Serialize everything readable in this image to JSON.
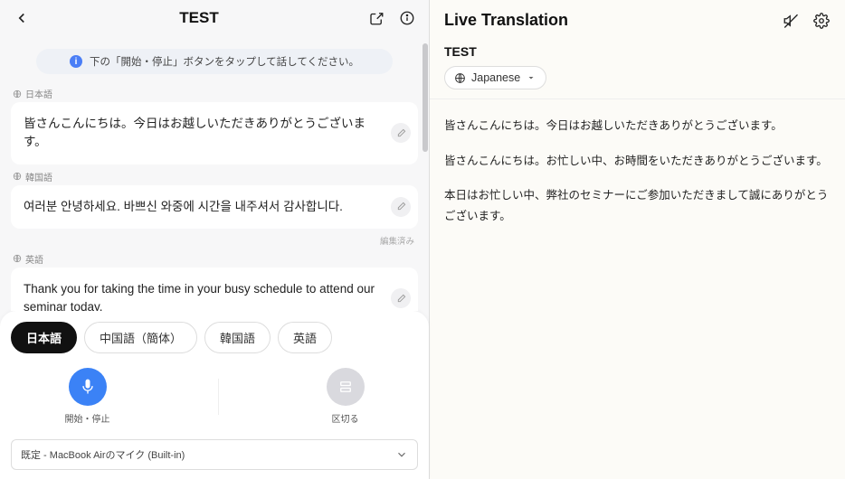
{
  "left": {
    "title": "TEST",
    "hint_text": "下の「開始・停止」ボタンをタップして話してください。",
    "blocks": [
      {
        "lang": "日本語",
        "text": "皆さんこんにちは。今日はお越しいただきありがとうございます。"
      },
      {
        "lang": "韓国語",
        "text": "여러분 안녕하세요. 바쁘신 와중에 시간을 내주셔서 감사합니다.",
        "edited": "編集済み"
      },
      {
        "lang": "英語",
        "text": "Thank you for taking the time in your busy schedule to attend our seminar today."
      }
    ],
    "lang_tabs": [
      "日本語",
      "中国語（簡体）",
      "韓国語",
      "英語"
    ],
    "active_tab": 0,
    "start_stop_label": "開始・停止",
    "divider_label": "区切る",
    "mic_selection": "既定 - MacBook Airのマイク (Built-in)"
  },
  "right": {
    "heading": "Live Translation",
    "subtitle": "TEST",
    "lang_chip": "Japanese",
    "lines": [
      "皆さんこんにちは。今日はお越しいただきありがとうございます。",
      "皆さんこんにちは。お忙しい中、お時間をいただきありがとうございます。",
      "本日はお忙しい中、弊社のセミナーにご参加いただきまして誠にありがとうございます。"
    ]
  }
}
